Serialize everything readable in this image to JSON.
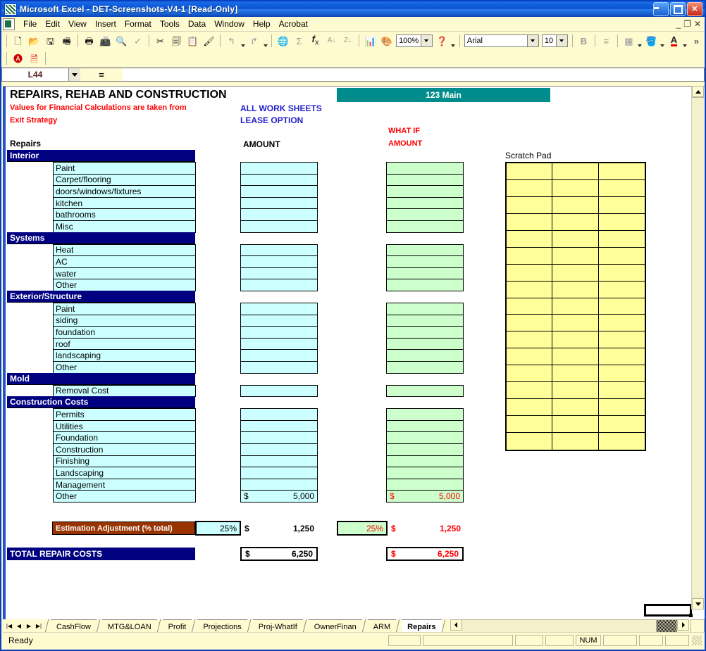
{
  "window": {
    "title": "Microsoft Excel - DET-Screenshots-V4-1  [Read-Only]",
    "icon": "excel-icon",
    "minimize": "_",
    "maximize": "□",
    "close": "✕"
  },
  "menubar": {
    "items": [
      "File",
      "Edit",
      "View",
      "Insert",
      "Format",
      "Tools",
      "Data",
      "Window",
      "Help",
      "Acrobat"
    ],
    "doc_minimize": "_",
    "doc_restore": "❐",
    "doc_close": "✕"
  },
  "toolbar": {
    "zoom_value": "100%",
    "font_name": "Arial",
    "font_size": "10",
    "bold_label": "B",
    "overflow_label": "»",
    "icons": [
      "new-icon",
      "open-icon",
      "save-icon",
      "email-icon",
      "print-icon",
      "fax-icon",
      "print-preview-icon",
      "spellcheck-icon",
      "cut-icon",
      "copy-icon",
      "paste-icon",
      "format-painter-icon",
      "undo-icon",
      "redo-icon",
      "hyperlink-icon",
      "autosum-icon",
      "function-icon",
      "sort-asc-icon",
      "sort-desc-icon",
      "chart-wizard-icon",
      "drawing-icon",
      "help-icon",
      "borders-icon",
      "fill-color-icon",
      "font-color-icon"
    ],
    "row2_icons": [
      "adobe-pdf-icon",
      "adobe-pdf-settings-icon"
    ]
  },
  "formula_bar": {
    "name_box": "L44",
    "equals": "=",
    "formula": ""
  },
  "sheet": {
    "title": "REPAIRS, REHAB AND CONSTRUCTION",
    "note_line1": "Values for Financial Calculations are taken from",
    "note_line2": "Exit Strategy",
    "link_line1": "ALL WORK SHEETS",
    "link_line2": "LEASE OPTION",
    "property_banner": "123 Main",
    "repairs_label": "Repairs",
    "amount_header": "AMOUNT",
    "whatif_header_line1": "WHAT IF",
    "whatif_header_line2": "AMOUNT",
    "scratch_pad_label": "Scratch Pad",
    "scratch_pad_rows": 17,
    "scratch_pad_cols": 3,
    "groups": [
      {
        "name": "Interior",
        "rows": [
          "Paint",
          "Carpet/flooring",
          "doors/windows/fixtures",
          "kitchen",
          "bathrooms",
          "Misc"
        ]
      },
      {
        "name": "Systems",
        "rows": [
          "Heat",
          "AC",
          "water",
          "Other"
        ]
      },
      {
        "name": "Exterior/Structure",
        "rows": [
          "Paint",
          "siding",
          "foundation",
          "roof",
          "landscaping",
          "Other"
        ]
      },
      {
        "name": "Mold",
        "rows": [
          "Removal Cost"
        ]
      },
      {
        "name": "Construction Costs",
        "rows": [
          "Permits",
          "Utilities",
          "Foundation",
          "Construction",
          "Finishing",
          "Landscaping",
          "Management",
          "Other"
        ]
      }
    ],
    "other_row_amount": {
      "currency": "$",
      "value": "5,000"
    },
    "other_row_whatif": {
      "currency": "$",
      "value": "5,000"
    },
    "estimation": {
      "label": "Estimation Adjustment (% total)",
      "amount_pct": "25%",
      "amount_currency": "$",
      "amount_value": "1,250",
      "whatif_pct": "25%",
      "whatif_currency": "$",
      "whatif_value": "1,250"
    },
    "total": {
      "label": "TOTAL REPAIR COSTS",
      "amount_currency": "$",
      "amount_value": "6,250",
      "whatif_currency": "$",
      "whatif_value": "6,250"
    }
  },
  "tabs": {
    "items": [
      "CashFlow",
      "MTG&LOAN",
      "Profit",
      "Projections",
      "Proj-WhatIf",
      "OwnerFinan",
      "ARM",
      "Repairs"
    ],
    "active": "Repairs",
    "nav_first": "|◀",
    "nav_prev": "◀",
    "nav_next": "▶",
    "nav_last": "▶|"
  },
  "status_bar": {
    "message": "Ready",
    "num_lock": "NUM"
  },
  "colors": {
    "group_header": "#000080",
    "banner_teal": "#008c8c",
    "input_cyan": "#ccffff",
    "input_green": "#ccffcc",
    "scratch_yellow": "#ffff99",
    "estimation_brown": "#993300",
    "alert_red": "#ff0000",
    "link_blue": "#2222cc"
  }
}
